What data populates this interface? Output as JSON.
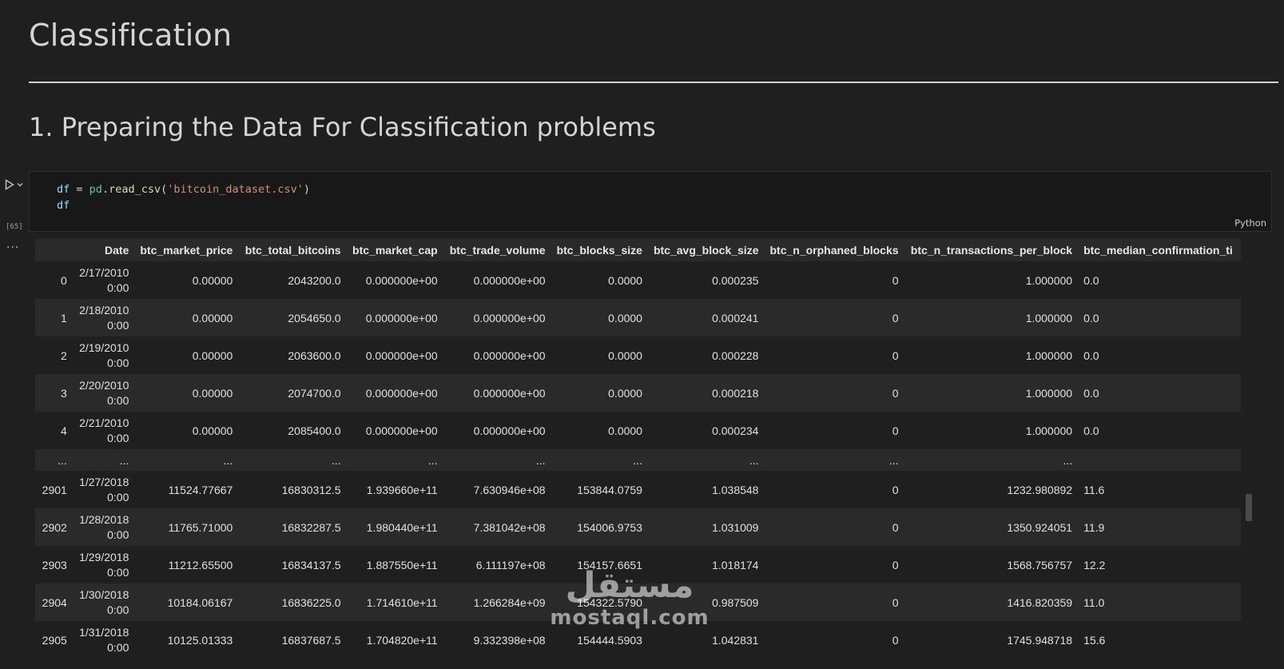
{
  "markdown": {
    "h1": "Classification",
    "h2": "1. Preparing the Data For Classification problems"
  },
  "cell": {
    "exec_count": "[65]",
    "language": "Python",
    "code_line1": {
      "var": "df",
      "op": " = ",
      "mod": "pd",
      "dot": ".",
      "fn": "read_csv",
      "paren_open": "(",
      "str": "'bitcoin_dataset.csv'",
      "paren_close": ")"
    },
    "code_line2": "df",
    "output_menu": "..."
  },
  "dataframe": {
    "columns": [
      "",
      "Date",
      "btc_market_price",
      "btc_total_bitcoins",
      "btc_market_cap",
      "btc_trade_volume",
      "btc_blocks_size",
      "btc_avg_block_size",
      "btc_n_orphaned_blocks",
      "btc_n_transactions_per_block",
      "btc_median_confirmation_ti"
    ],
    "rows": [
      [
        "0",
        "2/17/2010 0:00",
        "0.00000",
        "2043200.0",
        "0.000000e+00",
        "0.000000e+00",
        "0.0000",
        "0.000235",
        "0",
        "1.000000",
        "0.0"
      ],
      [
        "1",
        "2/18/2010 0:00",
        "0.00000",
        "2054650.0",
        "0.000000e+00",
        "0.000000e+00",
        "0.0000",
        "0.000241",
        "0",
        "1.000000",
        "0.0"
      ],
      [
        "2",
        "2/19/2010 0:00",
        "0.00000",
        "2063600.0",
        "0.000000e+00",
        "0.000000e+00",
        "0.0000",
        "0.000228",
        "0",
        "1.000000",
        "0.0"
      ],
      [
        "3",
        "2/20/2010 0:00",
        "0.00000",
        "2074700.0",
        "0.000000e+00",
        "0.000000e+00",
        "0.0000",
        "0.000218",
        "0",
        "1.000000",
        "0.0"
      ],
      [
        "4",
        "2/21/2010 0:00",
        "0.00000",
        "2085400.0",
        "0.000000e+00",
        "0.000000e+00",
        "0.0000",
        "0.000234",
        "0",
        "1.000000",
        "0.0"
      ],
      [
        "...",
        "...",
        "...",
        "...",
        "...",
        "...",
        "...",
        "...",
        "...",
        "...",
        ""
      ],
      [
        "2901",
        "1/27/2018 0:00",
        "11524.77667",
        "16830312.5",
        "1.939660e+11",
        "7.630946e+08",
        "153844.0759",
        "1.038548",
        "0",
        "1232.980892",
        "11.6"
      ],
      [
        "2902",
        "1/28/2018 0:00",
        "11765.71000",
        "16832287.5",
        "1.980440e+11",
        "7.381042e+08",
        "154006.9753",
        "1.031009",
        "0",
        "1350.924051",
        "11.9"
      ],
      [
        "2903",
        "1/29/2018 0:00",
        "11212.65500",
        "16834137.5",
        "1.887550e+11",
        "6.111197e+08",
        "154157.6651",
        "1.018174",
        "0",
        "1568.756757",
        "12.2"
      ],
      [
        "2904",
        "1/30/2018 0:00",
        "10184.06167",
        "16836225.0",
        "1.714610e+11",
        "1.266284e+09",
        "154322.5790",
        "0.987509",
        "0",
        "1416.820359",
        "11.0"
      ],
      [
        "2905",
        "1/31/2018 0:00",
        "10125.01333",
        "16837687.5",
        "1.704820e+11",
        "9.332398e+08",
        "154444.5903",
        "1.042831",
        "0",
        "1745.948718",
        "15.6"
      ]
    ]
  },
  "watermark": {
    "arabic": "مستقل",
    "latin": "mostaql.com"
  },
  "colors": {
    "background": "#1f1f1f",
    "row_alt": "#2a2a2a",
    "string": "#ce9178",
    "function": "#dcdcaa",
    "variable": "#9cdcfe"
  }
}
